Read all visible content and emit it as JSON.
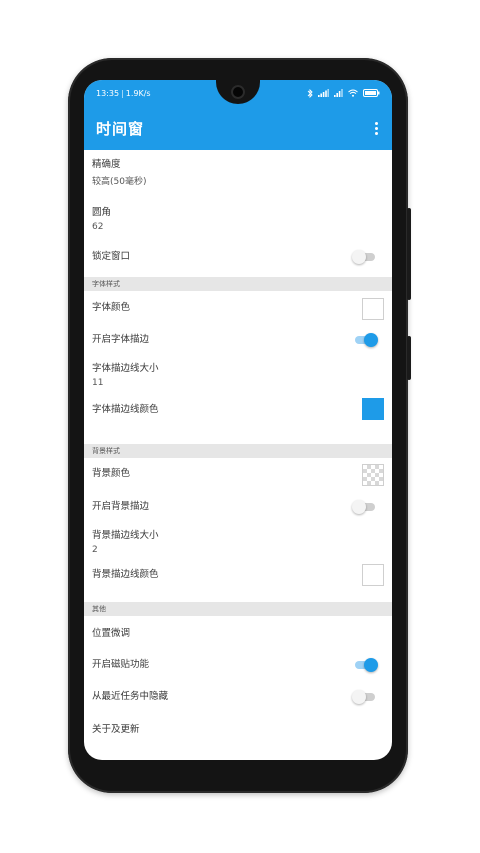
{
  "status_bar": {
    "time": "13:35",
    "speed": "1.9K/s",
    "battery_icon": "battery-icon",
    "signal_icon": "signal-icon",
    "wifi_icon": "wifi-icon",
    "bluetooth_icon": "bluetooth-icon"
  },
  "toolbar": {
    "title": "时间窗",
    "menu_icon": "more-vert-icon"
  },
  "colors": {
    "accent": "#1e9be8",
    "switch_on_track": "#9fd2f5",
    "section_bg": "#e6e6e6"
  },
  "settings": {
    "precision": {
      "label": "精确度",
      "value": "较高(50毫秒)"
    },
    "corner": {
      "label": "圆角",
      "value": "62"
    },
    "lock_window": {
      "label": "锁定窗口",
      "enabled": false
    },
    "font_section": {
      "header": "字体样式"
    },
    "font_color": {
      "label": "字体颜色",
      "color": "#ffffff"
    },
    "font_stroke": {
      "label": "开启字体描边",
      "enabled": true
    },
    "font_stroke_size": {
      "label": "字体描边线大小",
      "value": "11"
    },
    "font_stroke_color": {
      "label": "字体描边线颜色",
      "color": "#1e9be8"
    },
    "bg_section": {
      "header": "背景样式"
    },
    "bg_color": {
      "label": "背景颜色",
      "color": "transparent"
    },
    "bg_stroke": {
      "label": "开启背景描边",
      "enabled": false
    },
    "bg_stroke_size": {
      "label": "背景描边线大小",
      "value": "2"
    },
    "bg_stroke_color": {
      "label": "背景描边线颜色",
      "color": "#ffffff"
    },
    "other_section": {
      "header": "其他"
    },
    "position_adjust": {
      "label": "位置微调"
    },
    "snap": {
      "label": "开启磁贴功能",
      "enabled": true
    },
    "hide_recents": {
      "label": "从最近任务中隐藏",
      "enabled": false
    },
    "about": {
      "label": "关于及更新"
    }
  }
}
